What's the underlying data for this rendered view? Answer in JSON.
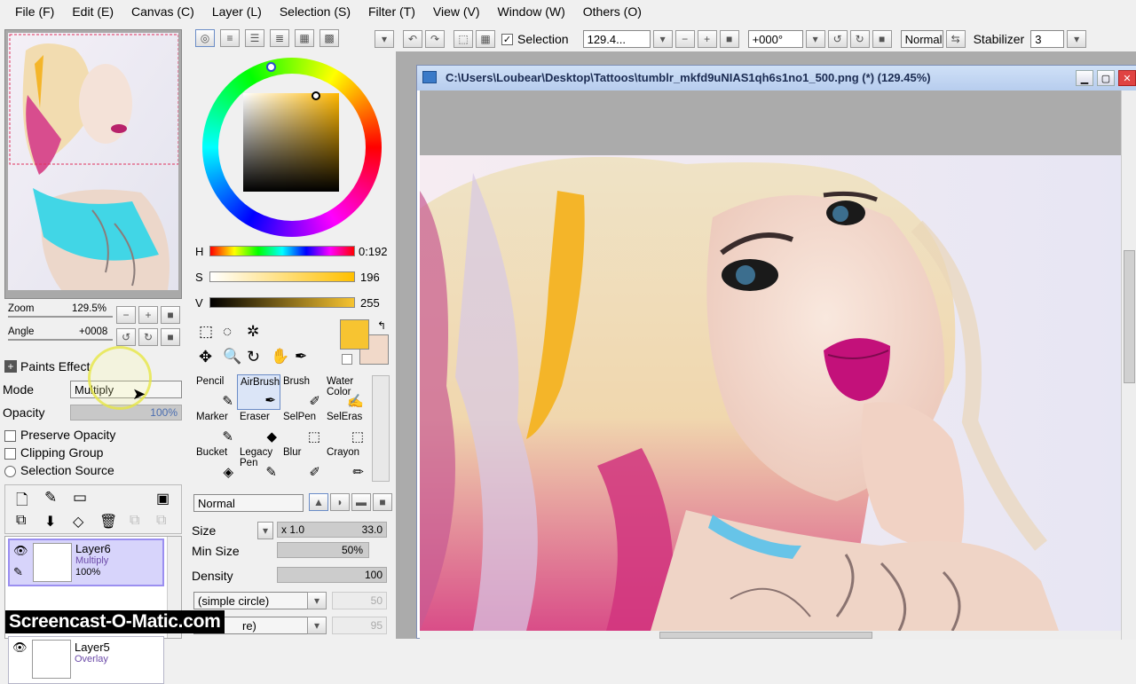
{
  "menu": [
    "File (F)",
    "Edit (E)",
    "Canvas (C)",
    "Layer (L)",
    "Selection (S)",
    "Filter (T)",
    "View (V)",
    "Window (W)",
    "Others (O)"
  ],
  "toolbar": {
    "selection_label": "Selection",
    "zoom_value": "129.4...",
    "angle_value": "+000°",
    "blend": "Normal",
    "stabilizer_label": "Stabilizer",
    "stabilizer_value": "3",
    "selection_checked": true
  },
  "navigator": {
    "zoom_label": "Zoom",
    "zoom_value": "129.5%",
    "angle_label": "Angle",
    "angle_value": "+0008"
  },
  "paints_effect": {
    "title": "Paints Effect",
    "mode_label": "Mode",
    "mode_value": "Multiply",
    "opacity_label": "Opacity",
    "opacity_value": "100%",
    "options": [
      "Preserve Opacity",
      "Clipping Group",
      "Selection Source"
    ]
  },
  "layers": [
    {
      "name": "Layer6",
      "mode": "Multiply",
      "opacity": "100%",
      "selected": true
    },
    {
      "name": "Layer5",
      "mode": "Overlay",
      "opacity": "",
      "selected": false
    }
  ],
  "color": {
    "h_label": "H",
    "h_value": "0:192",
    "s_label": "S",
    "s_value": "196",
    "v_label": "V",
    "v_value": "255",
    "primary": "#f7c431",
    "secondary": "#f1d9c9"
  },
  "tools": [
    {
      "name": "Pencil",
      "icon": "✎"
    },
    {
      "name": "AirBrush",
      "icon": "✒"
    },
    {
      "name": "Brush",
      "icon": "✐"
    },
    {
      "name": "Water Color",
      "icon": "✍"
    },
    {
      "name": "Marker",
      "icon": "✎"
    },
    {
      "name": "Eraser",
      "icon": "◆"
    },
    {
      "name": "SelPen",
      "icon": "⬚"
    },
    {
      "name": "SelEras",
      "icon": "⬚"
    },
    {
      "name": "Bucket",
      "icon": "◈"
    },
    {
      "name": "Legacy Pen",
      "icon": "✎"
    },
    {
      "name": "Blur",
      "icon": "✐"
    },
    {
      "name": "Crayon",
      "icon": "✏"
    }
  ],
  "brush": {
    "blend": "Normal",
    "size_label": "Size",
    "size_mult": "x 1.0",
    "size_value": "33.0",
    "minsize_label": "Min Size",
    "minsize_value": "50%",
    "density_label": "Density",
    "density_value": "100",
    "shape1": "(simple circle)",
    "shape1_val": "50",
    "shape2": "re)",
    "shape2_val": "95"
  },
  "canvas": {
    "title": "C:\\Users\\Loubear\\Desktop\\Tattoos\\tumblr_mkfd9uNIAS1qh6s1no1_500.png (*) (129.45%)"
  },
  "watermark": "Screencast-O-Matic.com"
}
